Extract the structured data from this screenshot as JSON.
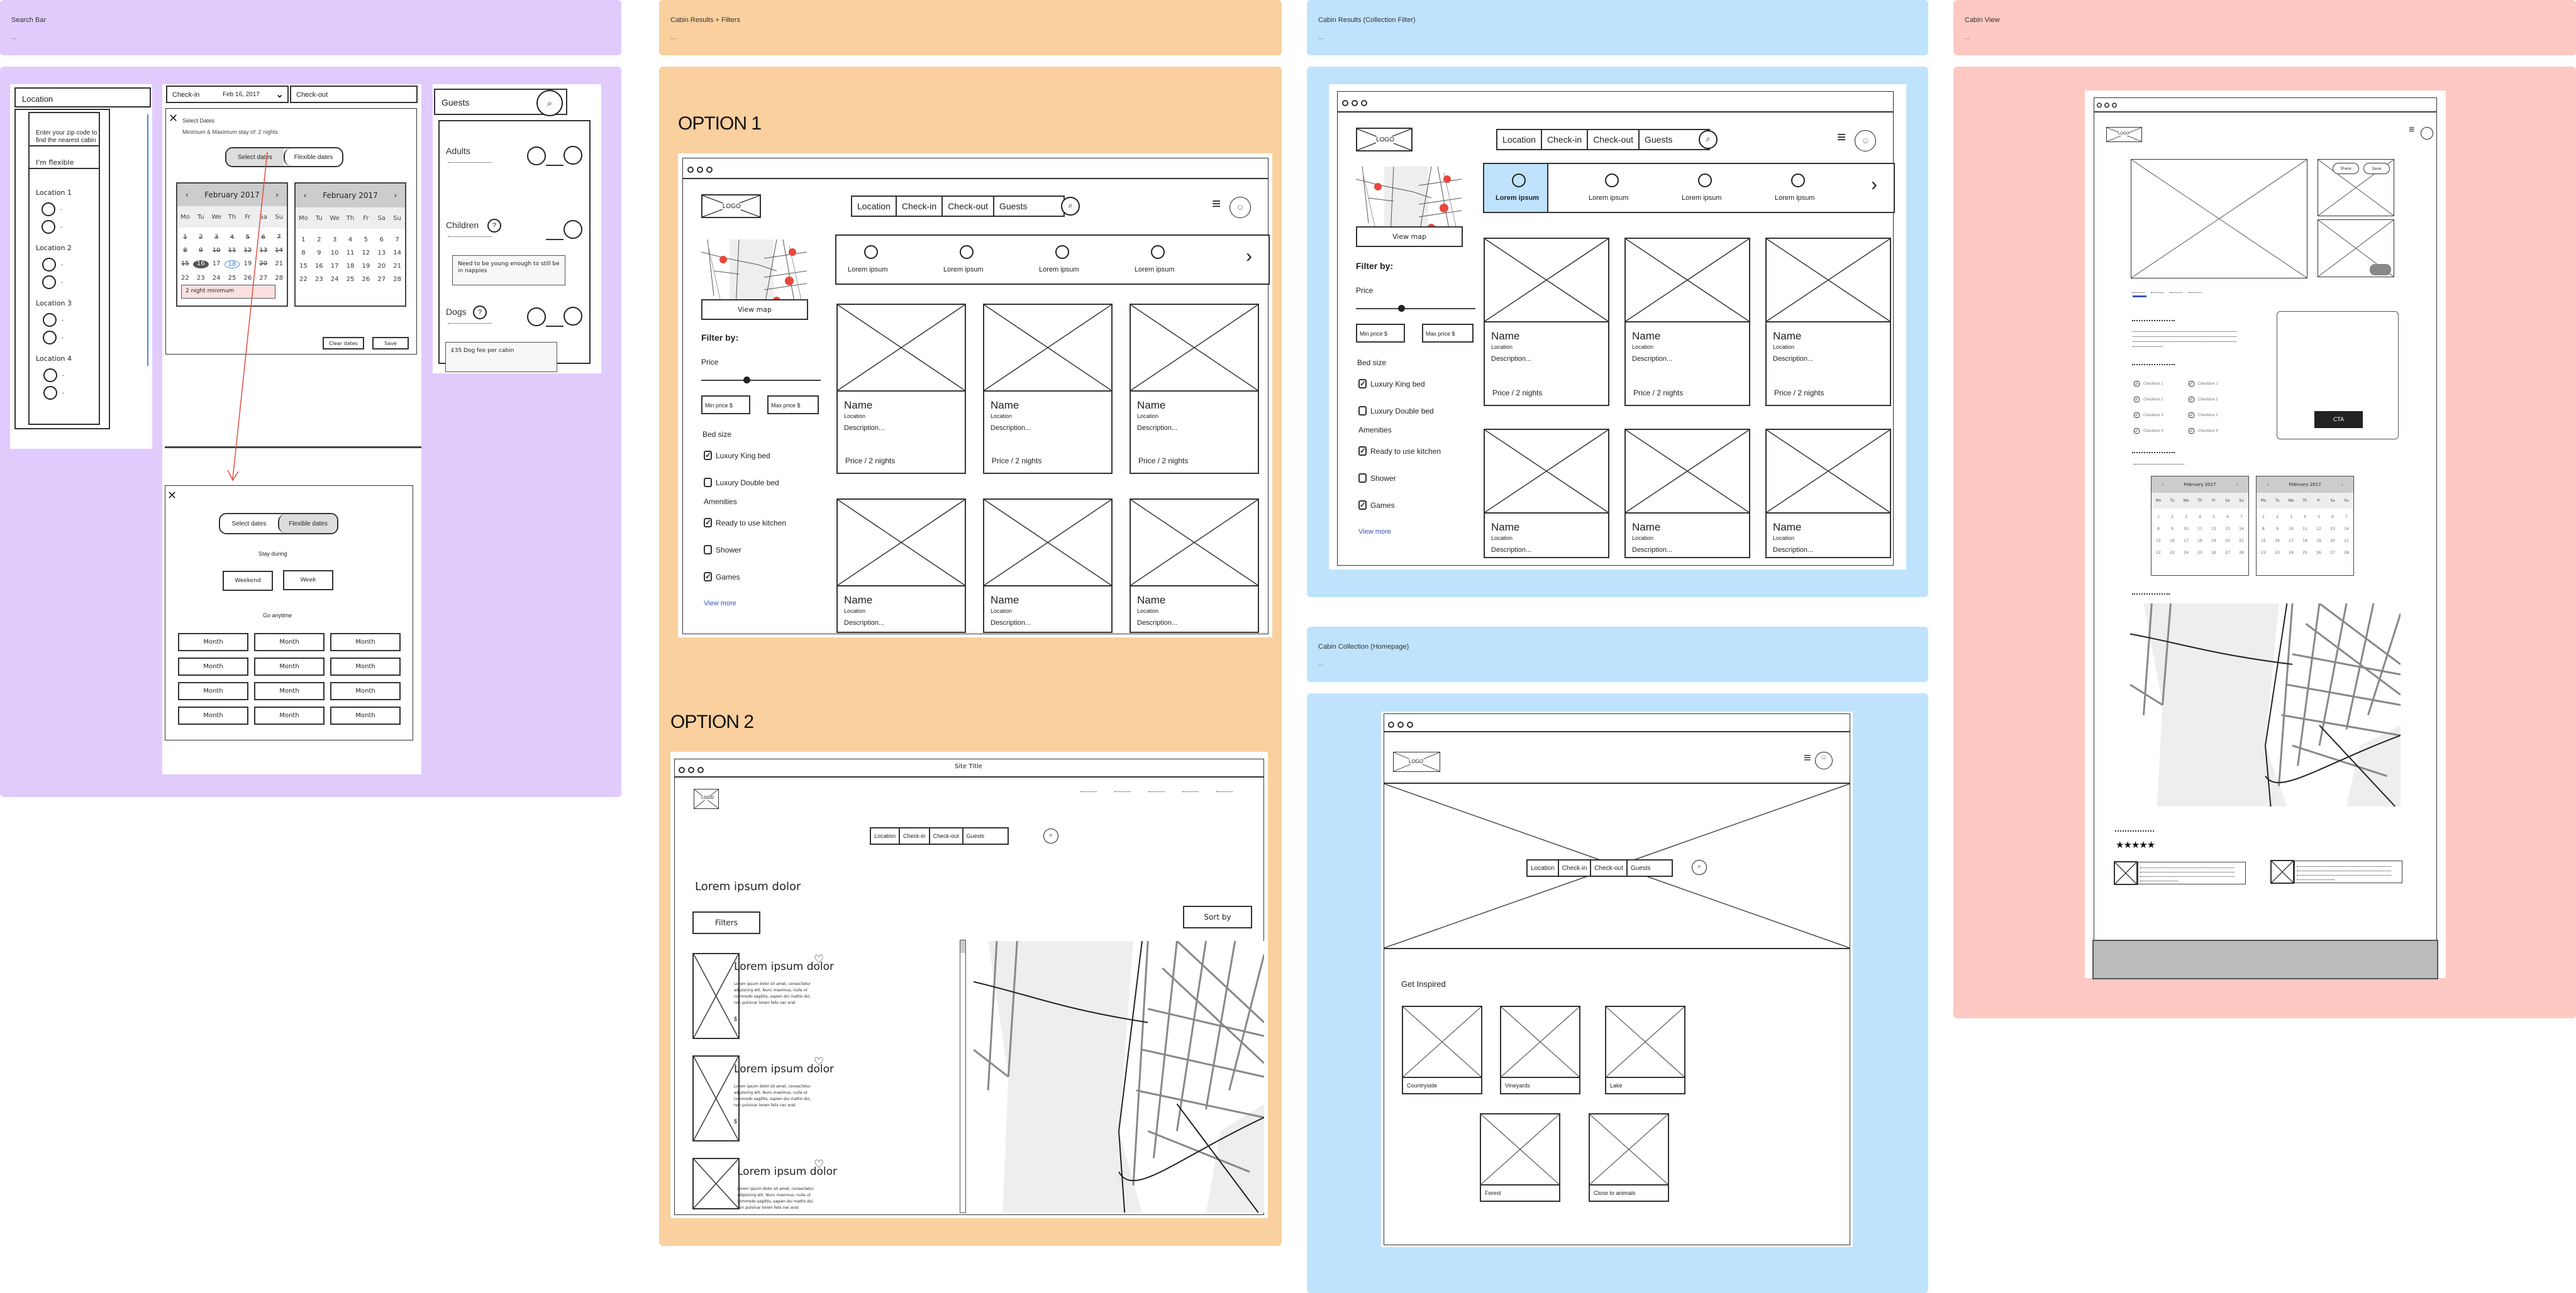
{
  "sections": {
    "search_bar": {
      "title": "Search Bar",
      "desc": "..."
    },
    "cabin_results_filters": {
      "title": "Cabin Results + Filters",
      "desc": "..."
    },
    "cabin_results_collection": {
      "title": "Cabin Results (Collection Filter)",
      "desc": "..."
    },
    "cabin_collection_home": {
      "title": "Cabin Collection (Homepage)",
      "desc": "..."
    },
    "cabin_view": {
      "title": "Cabin View",
      "desc": "..."
    }
  },
  "colors": {
    "purple": "#e1cbfd",
    "orange": "#f9d09e",
    "blue": "#bfe3fc",
    "pink": "#fec8c3",
    "link": "#3a55b4",
    "highlight": "#bfe3fc",
    "red_pin": "#e8473a"
  },
  "location_dropdown": {
    "field_label": "Location",
    "zip_prompt": "Enter your zip code to find the nearest cabin",
    "flexible": "I'm flexible",
    "groups": [
      {
        "label": "Location 1",
        "options": [
          "-",
          "-"
        ]
      },
      {
        "label": "Location 2",
        "options": [
          "-",
          "-"
        ]
      },
      {
        "label": "Location 3",
        "options": [
          "-",
          "-"
        ]
      },
      {
        "label": "Location 4",
        "options": [
          "-",
          "-"
        ]
      }
    ]
  },
  "dates": {
    "checkin_label": "Check-in",
    "checkin_value": "Feb 16, 2017",
    "checkout_label": "Check-out",
    "modal_title": "Select Dates",
    "stay_note": "Minimum & Maximum stay of: 2 nights",
    "toggle": [
      "Select dates",
      "Flexible dates"
    ],
    "month_title": "February 2017",
    "weekdays": [
      "Mo",
      "Tu",
      "We",
      "Th",
      "Fr",
      "Sa",
      "Su"
    ],
    "days": [
      "1",
      "2",
      "3",
      "4",
      "5",
      "6",
      "7",
      "8",
      "9",
      "10",
      "11",
      "12",
      "13",
      "14",
      "15",
      "16",
      "17",
      "18",
      "19",
      "20",
      "21",
      "22",
      "23",
      "24",
      "25",
      "26",
      "27",
      "28"
    ],
    "selected_day": "16",
    "hover_day": "18",
    "tooltip": "2 night minimum",
    "clear_label": "Clear dates",
    "save_label": "Save",
    "flexible": {
      "stay_during": "Stay during",
      "stay_options": [
        "Weekend",
        "Week"
      ],
      "go_anytime": "Go anytime",
      "months": [
        "Month",
        "Month",
        "Month",
        "Month",
        "Month",
        "Month",
        "Month",
        "Month",
        "Month",
        "Month",
        "Month",
        "Month"
      ]
    }
  },
  "guests": {
    "field_label": "Guests",
    "rows": [
      {
        "label": "Adults",
        "help": false
      },
      {
        "label": "Children",
        "help": true,
        "tooltip": "Need to be young enough to still be in nappies"
      },
      {
        "label": "Dogs",
        "help": true,
        "tooltip": "£35 Dog fee per cabin"
      }
    ]
  },
  "option1": {
    "heading": "OPTION 1",
    "logo": "LOGO",
    "search": [
      "Location",
      "Check-in",
      "Check-out",
      "Guests"
    ],
    "collections": [
      "Lorem ipsum",
      "Lorem ipsum",
      "Lorem ipsum",
      "Lorem ipsum"
    ],
    "view_map": "View map",
    "filter_by": "Filter by:",
    "price_label": "Price",
    "min_price": "Min price $",
    "max_price": "Max price $",
    "price_slider_fraction": 0.38,
    "bed_size_label": "Bed size",
    "bed_options": [
      {
        "label": "Luxury King bed",
        "checked": true
      },
      {
        "label": "Luxury Double bed",
        "checked": false
      }
    ],
    "amenities_label": "Amenities",
    "amenities": [
      {
        "label": "Ready to use kitchen",
        "checked": true
      },
      {
        "label": "Shower",
        "checked": false
      },
      {
        "label": "Games",
        "checked": true
      }
    ],
    "view_more": "View more",
    "cards": [
      {
        "name": "Name",
        "location": "Location",
        "description": "Description...",
        "price": "Price / 2 nights"
      },
      {
        "name": "Name",
        "location": "Location",
        "description": "Description...",
        "price": "Price / 2 nights"
      },
      {
        "name": "Name",
        "location": "Location",
        "description": "Description...",
        "price": "Price / 2 nights"
      },
      {
        "name": "Name",
        "location": "Location",
        "description": "Description..."
      },
      {
        "name": "Name",
        "location": "Location",
        "description": "Description..."
      },
      {
        "name": "Name",
        "location": "Location",
        "description": "Description..."
      }
    ]
  },
  "option2": {
    "heading": "OPTION 2",
    "site_title": "Site Title",
    "logo": "LOGO",
    "search": [
      "Location",
      "Check-in",
      "Check-out",
      "Guests"
    ],
    "page_heading": "Lorem ipsum dolor",
    "filters_label": "Filters",
    "sort_label": "Sort by",
    "listings": [
      {
        "title": "Lorem ipsum dolor",
        "body": "Lorem ipsum dolor sit amet, consectetur adipiscing elit. Nunc maximus, nulla ut commodo sagittis, sapien dui mattis dui, non pulvinar lorem felis nec erat",
        "price": "$"
      },
      {
        "title": "Lorem ipsum dolor",
        "body": "Lorem ipsum dolor sit amet, consectetur adipiscing elit. Nunc maximus, nulla ut commodo sagittis, sapien dui mattis dui, non pulvinar lorem felis nec erat",
        "price": "$"
      },
      {
        "title": "Lorem ipsum dolor",
        "body": "Lorem ipsum dolor sit amet, consectetur adipiscing elit. Nunc maximus, nulla ut commodo sagittis, sapien dui mattis dui, non pulvinar lorem felis nec erat",
        "price": ""
      }
    ]
  },
  "collection_filter": {
    "logo": "LOGO",
    "search": [
      "Location",
      "Check-in",
      "Check-out",
      "Guests"
    ],
    "collections": [
      "Lorem ipsum",
      "Lorem ipsum",
      "Lorem ipsum",
      "Lorem ipsum"
    ],
    "active_collection": 0,
    "view_map": "View map",
    "filter_by": "Filter by:",
    "price_label": "Price",
    "min_price": "Min price $",
    "max_price": "Max price $",
    "price_slider_fraction": 0.38,
    "bed_size_label": "Bed size",
    "bed_options": [
      {
        "label": "Luxury King bed",
        "checked": true
      },
      {
        "label": "Luxury Double bed",
        "checked": false
      }
    ],
    "amenities_label": "Amenities",
    "amenities": [
      {
        "label": "Ready to use kitchen",
        "checked": true
      },
      {
        "label": "Shower",
        "checked": false
      },
      {
        "label": "Games",
        "checked": true
      }
    ],
    "view_more": "View more",
    "cards": [
      {
        "name": "Name",
        "location": "Location",
        "description": "Description...",
        "price": "Price / 2 nights"
      },
      {
        "name": "Name",
        "location": "Location",
        "description": "Description...",
        "price": "Price / 2 nights"
      },
      {
        "name": "Name",
        "location": "Location",
        "description": "Description...",
        "price": "Price / 2 nights"
      },
      {
        "name": "Name",
        "location": "Location",
        "description": "Description..."
      },
      {
        "name": "Name",
        "location": "Location",
        "description": "Description..."
      },
      {
        "name": "Name",
        "location": "Location",
        "description": "Description..."
      }
    ]
  },
  "homepage": {
    "logo": "LOGO",
    "search": [
      "Location",
      "Check-in",
      "Check-out",
      "Guests"
    ],
    "inspired_heading": "Get Inspired",
    "categories": [
      "Countryside",
      "Vineyards",
      "Lake",
      "Forest",
      "Close to animals"
    ]
  },
  "cabin_view": {
    "logo": "LOGO",
    "share_label": "Share",
    "save_label": "Save",
    "cta_label": "CTA",
    "checkboxes": [
      "Checkbox 1",
      "Checkbox 1",
      "Checkbox 2",
      "Checkbox 2",
      "Checkbox 3",
      "Checkbox 3",
      "Checkbox 4",
      "Checkbox 4"
    ],
    "month_title": "February 2017",
    "weekdays": [
      "Mo",
      "Tu",
      "We",
      "Th",
      "Fr",
      "Sa",
      "Su"
    ],
    "rating_stars": 5
  }
}
